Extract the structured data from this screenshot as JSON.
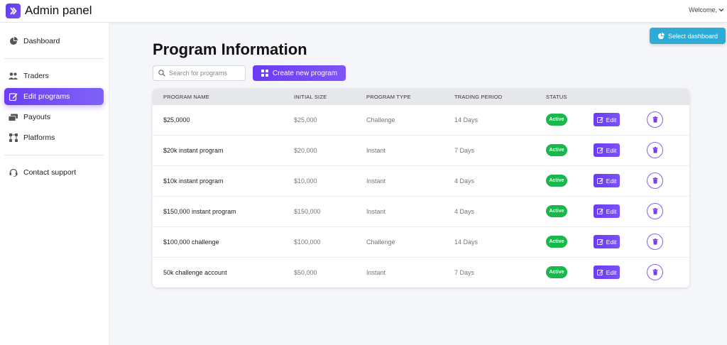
{
  "app": {
    "title": "Admin panel",
    "welcome": "Welcome,"
  },
  "sidebar": {
    "items": [
      {
        "label": "Dashboard",
        "icon": "pie-chart-icon"
      },
      {
        "label": "Traders",
        "icon": "users-icon"
      },
      {
        "label": "Edit programs",
        "icon": "edit-icon",
        "active": true
      },
      {
        "label": "Payouts",
        "icon": "payouts-icon"
      },
      {
        "label": "Platforms",
        "icon": "platforms-icon"
      },
      {
        "label": "Contact support",
        "icon": "headset-icon"
      }
    ]
  },
  "header": {
    "select_dashboard": "Select dashboard"
  },
  "main": {
    "title": "Program Information",
    "search_placeholder": "Search for programs",
    "create_label": "Create new program",
    "columns": [
      "PROGRAM NAME",
      "INITIAL SIZE",
      "PROGRAM TYPE",
      "TRADING PERIOD",
      "STATUS"
    ],
    "rows": [
      {
        "name": "$25,0000",
        "size": "$25,000",
        "type": "Challenge",
        "period": "14 Days",
        "status": "Active"
      },
      {
        "name": "$20k instant program",
        "size": "$20,000",
        "type": "Instant",
        "period": "7 Days",
        "status": "Active"
      },
      {
        "name": "$10k instant program",
        "size": "$10,000",
        "type": "Instant",
        "period": "4 Days",
        "status": "Active"
      },
      {
        "name": "$150,000 instant program",
        "size": "$150,000",
        "type": "Instant",
        "period": "4 Days",
        "status": "Active"
      },
      {
        "name": "$100,000 challenge",
        "size": "$100,000",
        "type": "Challenge",
        "period": "14 Days",
        "status": "Active"
      },
      {
        "name": "50k challenge account",
        "size": "$50,000",
        "type": "Instant",
        "period": "7 Days",
        "status": "Active"
      }
    ],
    "edit_label": "Edit"
  },
  "colors": {
    "accent": "#6c3df5",
    "active_badge": "#19b84c",
    "select_dashboard": "#2eaad6"
  }
}
